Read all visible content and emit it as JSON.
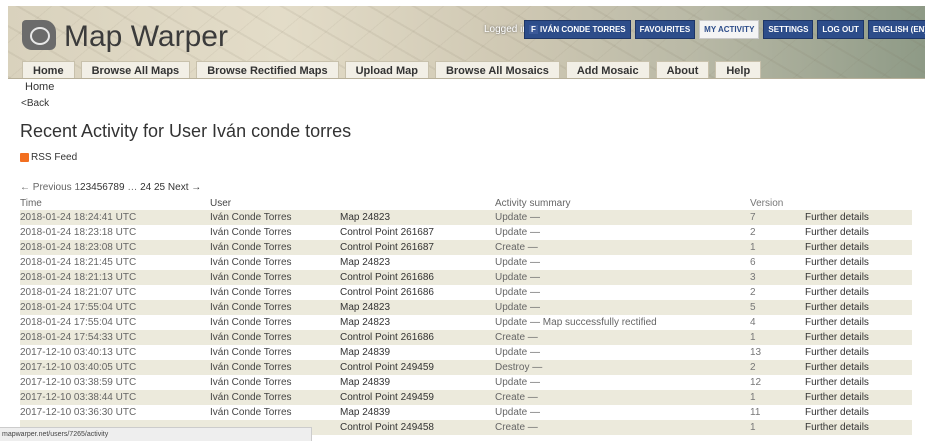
{
  "header": {
    "logo_text": "Map Warper",
    "logged_in_label": "Logged in as:",
    "top_buttons": [
      "IVÁN CONDE TORRES",
      "FAVOURITES",
      "MY ACTIVITY",
      "SETTINGS",
      "LOG OUT",
      "ENGLISH (EN)"
    ]
  },
  "nav": [
    "Home",
    "Browse All Maps",
    "Browse Rectified Maps",
    "Upload Map",
    "Browse All Mosaics",
    "Add Mosaic",
    "About",
    "Help"
  ],
  "breadcrumb": "Home",
  "back_link": "<Back",
  "page_title": "Recent Activity for User Iván conde torres",
  "rss_label": "RSS Feed",
  "pagination": {
    "previous": "← Previous",
    "current": "1",
    "pages": [
      "2",
      "3",
      "4",
      "5",
      "6",
      "7",
      "8",
      "9"
    ],
    "gap": "…",
    "tail": [
      "24",
      "25"
    ],
    "next": "Next →"
  },
  "table": {
    "headers": [
      "Time",
      "User",
      "",
      "Activity summary",
      "Version",
      ""
    ],
    "rows": [
      [
        "2018-01-24 18:24:41 UTC",
        "Iván Conde Torres",
        "Map 24823",
        "Update —",
        "7",
        "Further details"
      ],
      [
        "2018-01-24 18:23:18 UTC",
        "Iván Conde Torres",
        "Control Point 261687",
        "Update —",
        "2",
        "Further details"
      ],
      [
        "2018-01-24 18:23:08 UTC",
        "Iván Conde Torres",
        "Control Point 261687",
        "Create —",
        "1",
        "Further details"
      ],
      [
        "2018-01-24 18:21:45 UTC",
        "Iván Conde Torres",
        "Map 24823",
        "Update —",
        "6",
        "Further details"
      ],
      [
        "2018-01-24 18:21:13 UTC",
        "Iván Conde Torres",
        "Control Point 261686",
        "Update —",
        "3",
        "Further details"
      ],
      [
        "2018-01-24 18:21:07 UTC",
        "Iván Conde Torres",
        "Control Point 261686",
        "Update —",
        "2",
        "Further details"
      ],
      [
        "2018-01-24 17:55:04 UTC",
        "Iván Conde Torres",
        "Map 24823",
        "Update —",
        "5",
        "Further details"
      ],
      [
        "2018-01-24 17:55:04 UTC",
        "Iván Conde Torres",
        "Map 24823",
        "Update — Map successfully rectified",
        "4",
        "Further details"
      ],
      [
        "2018-01-24 17:54:33 UTC",
        "Iván Conde Torres",
        "Control Point 261686",
        "Create —",
        "1",
        "Further details"
      ],
      [
        "2017-12-10 03:40:13 UTC",
        "Iván Conde Torres",
        "Map 24839",
        "Update —",
        "13",
        "Further details"
      ],
      [
        "2017-12-10 03:40:05 UTC",
        "Iván Conde Torres",
        "Control Point 249459",
        "Destroy —",
        "2",
        "Further details"
      ],
      [
        "2017-12-10 03:38:59 UTC",
        "Iván Conde Torres",
        "Map 24839",
        "Update —",
        "12",
        "Further details"
      ],
      [
        "2017-12-10 03:38:44 UTC",
        "Iván Conde Torres",
        "Control Point 249459",
        "Create —",
        "1",
        "Further details"
      ],
      [
        "2017-12-10 03:36:30 UTC",
        "Iván Conde Torres",
        "Map 24839",
        "Update —",
        "11",
        "Further details"
      ],
      [
        "",
        "",
        "Control Point 249458",
        "Create —",
        "1",
        "Further details"
      ]
    ]
  },
  "status_url": "mapwarper.net/users/7265/activity"
}
